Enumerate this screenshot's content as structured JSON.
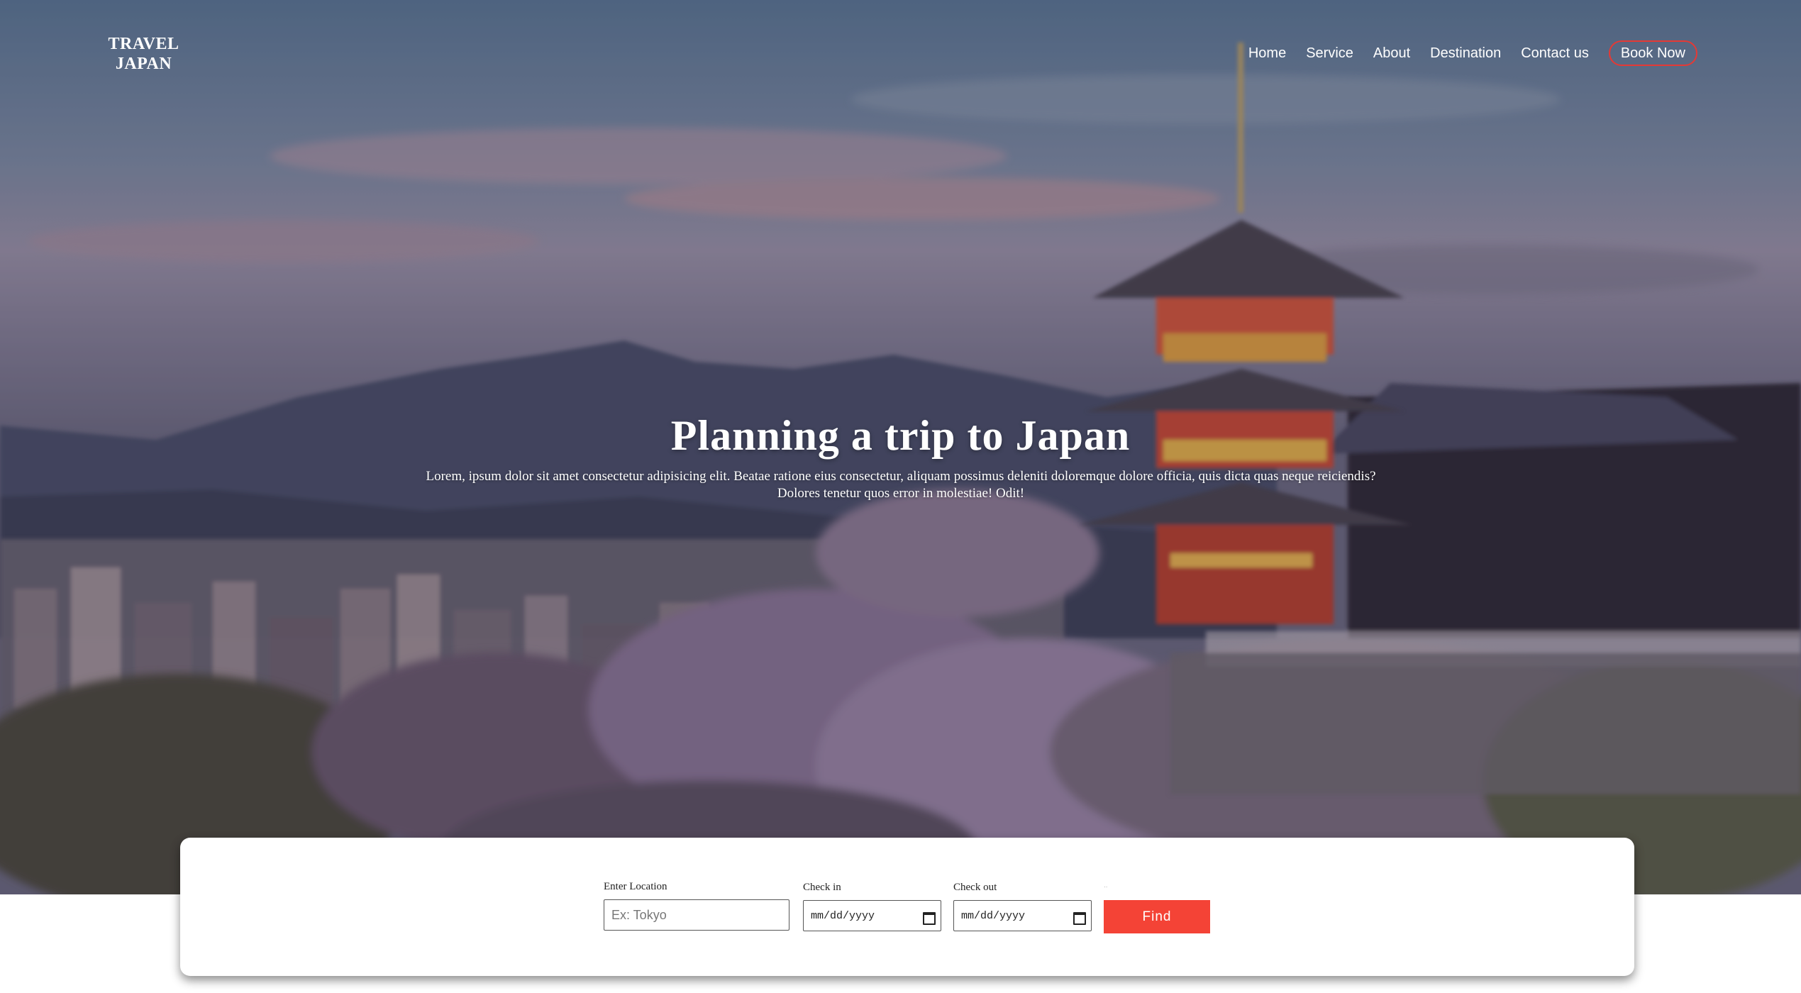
{
  "brand": {
    "line1": "TRAVEL",
    "line2": "JAPAN"
  },
  "nav": {
    "items": [
      "Home",
      "Service",
      "About",
      "Destination",
      "Contact us"
    ],
    "cta": "Book Now",
    "cta_color": "#e53935"
  },
  "hero": {
    "title": "Planning a trip to Japan",
    "subtitle_line1": "Lorem, ipsum dolor sit amet consectetur adipisicing elit. Beatae ratione eius consectetur, aliquam possimus deleniti doloremque dolore officia, quis dicta quas neque reiciendis?",
    "subtitle_line2": "Dolores tenetur quos error in molestiae! Odit!"
  },
  "search": {
    "location_label": "Enter Location",
    "location_placeholder": "Ex: Tokyo",
    "checkin_label": "Check in",
    "checkin_value": "mm/dd/yyyy",
    "checkout_label": "Check out",
    "checkout_value": "mm/dd/yyyy",
    "find_ghost_label": "..",
    "find_label": "Find",
    "find_color": "#f44336"
  }
}
